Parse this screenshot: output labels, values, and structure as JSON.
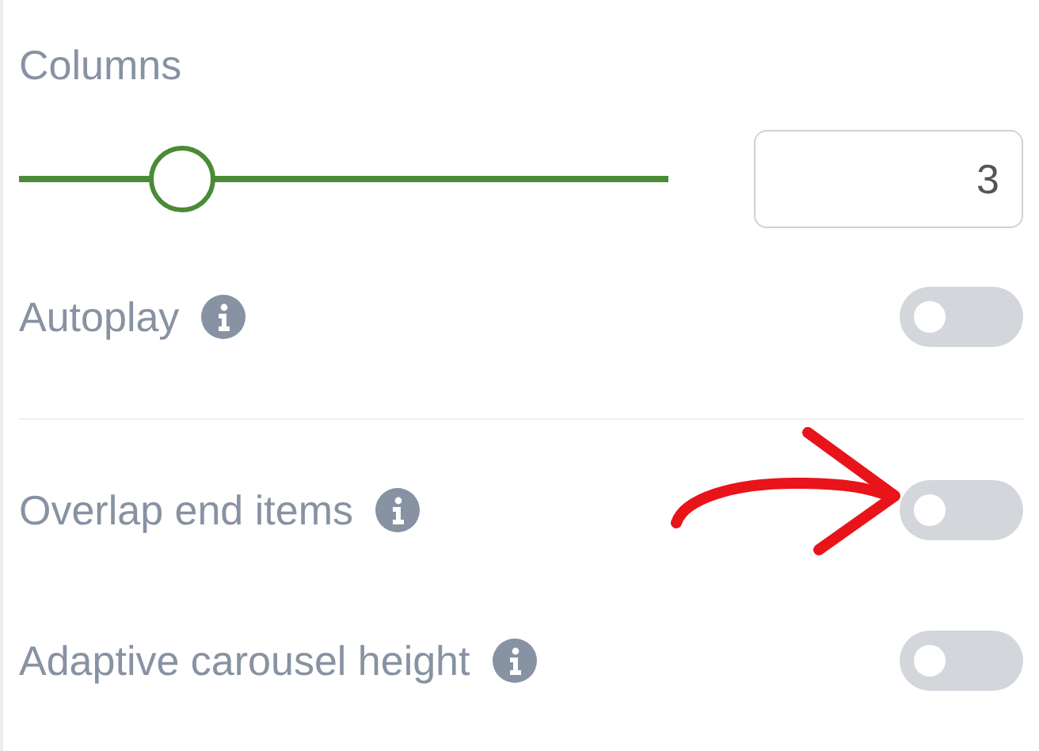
{
  "columns": {
    "label": "Columns",
    "level": 0.25,
    "value": "3"
  },
  "sections": [
    {
      "toggles": [
        {
          "label": "Autoplay",
          "info": true,
          "on": false
        }
      ]
    },
    {
      "toggles": [
        {
          "label": "Overlap end items",
          "info": true,
          "on": false
        },
        {
          "label": "Adaptive carousel height",
          "info": true,
          "on": false
        }
      ]
    }
  ]
}
